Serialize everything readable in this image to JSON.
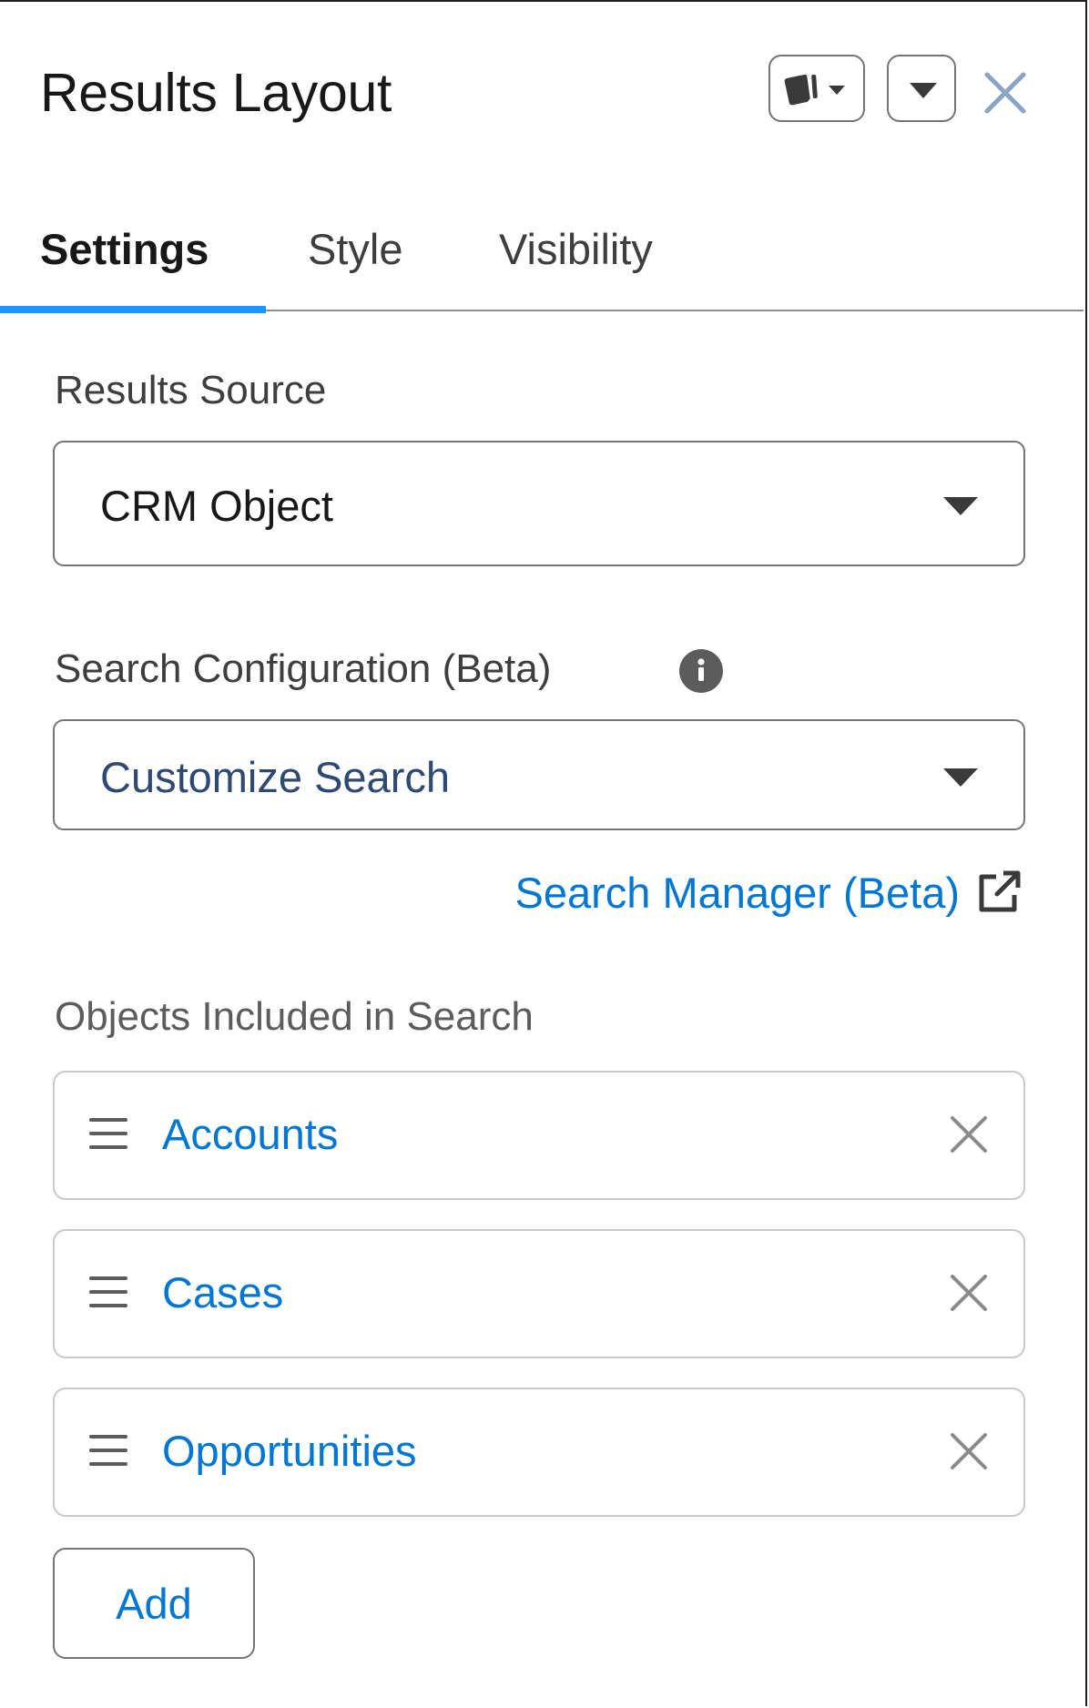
{
  "header": {
    "title": "Results Layout",
    "variant_button_icon": "cards-variant-icon",
    "menu_button_icon": "chevron-down-icon",
    "close_icon": "close-icon"
  },
  "tabs": [
    {
      "label": "Settings",
      "active": true
    },
    {
      "label": "Style",
      "active": false
    },
    {
      "label": "Visibility",
      "active": false
    }
  ],
  "results_source": {
    "label": "Results Source",
    "value": "CRM Object"
  },
  "search_configuration": {
    "label": "Search Configuration (Beta)",
    "value": "Customize Search",
    "info_icon": "info-icon"
  },
  "search_manager_link": {
    "label": "Search Manager (Beta)",
    "icon": "external-link-icon"
  },
  "objects": {
    "label": "Objects Included in Search",
    "items": [
      {
        "label": "Accounts"
      },
      {
        "label": "Cases"
      },
      {
        "label": "Opportunities"
      }
    ],
    "add_label": "Add"
  },
  "colors": {
    "accent": "#1b96ff",
    "link": "#0176d3",
    "select_value": "#2e4a72"
  }
}
